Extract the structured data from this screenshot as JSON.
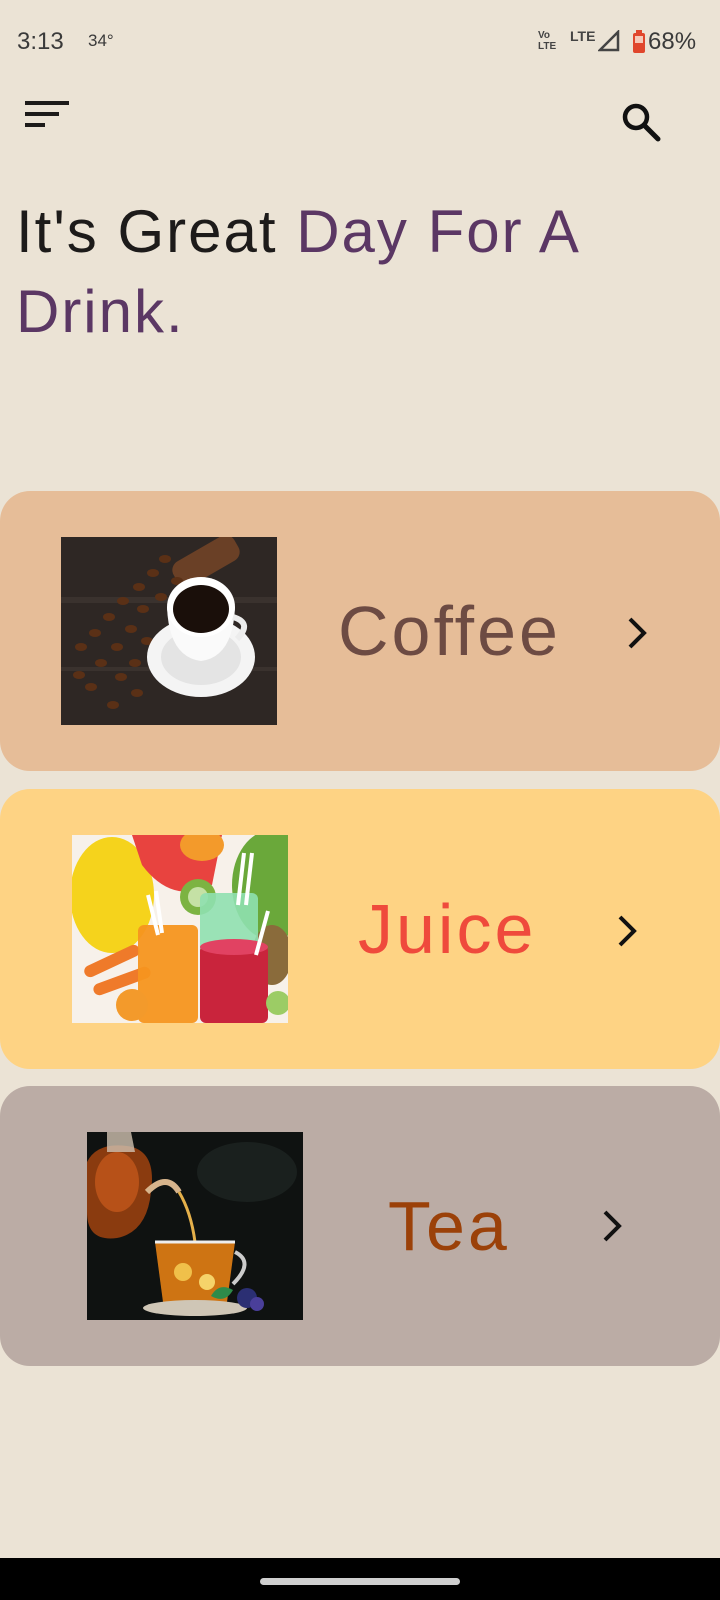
{
  "status_bar": {
    "time": "3:13",
    "temperature": "34°",
    "volte": "Vo LTE",
    "network": "LTE",
    "battery": "68%"
  },
  "app_bar": {
    "menu_icon": "sort-menu-icon",
    "search_icon": "search-icon"
  },
  "headline": {
    "part1": "It's Great ",
    "part2": "Day For A Drink."
  },
  "colors": {
    "background": "#ebe3d5",
    "accent": "#5b3764",
    "coffee_card": "#e6bd98",
    "juice_card": "#fed384",
    "tea_card": "#bbaca5",
    "coffee_text": "#6d4b43",
    "juice_text": "#ef4a3c",
    "tea_text": "#9b4109"
  },
  "categories": [
    {
      "label": "Coffee",
      "image": "coffee-cup-with-beans",
      "icon": "chevron-right-icon"
    },
    {
      "label": "Juice",
      "image": "fruit-juice-glasses",
      "icon": "chevron-right-icon"
    },
    {
      "label": "Tea",
      "image": "tea-pouring-into-cup",
      "icon": "chevron-right-icon"
    }
  ]
}
